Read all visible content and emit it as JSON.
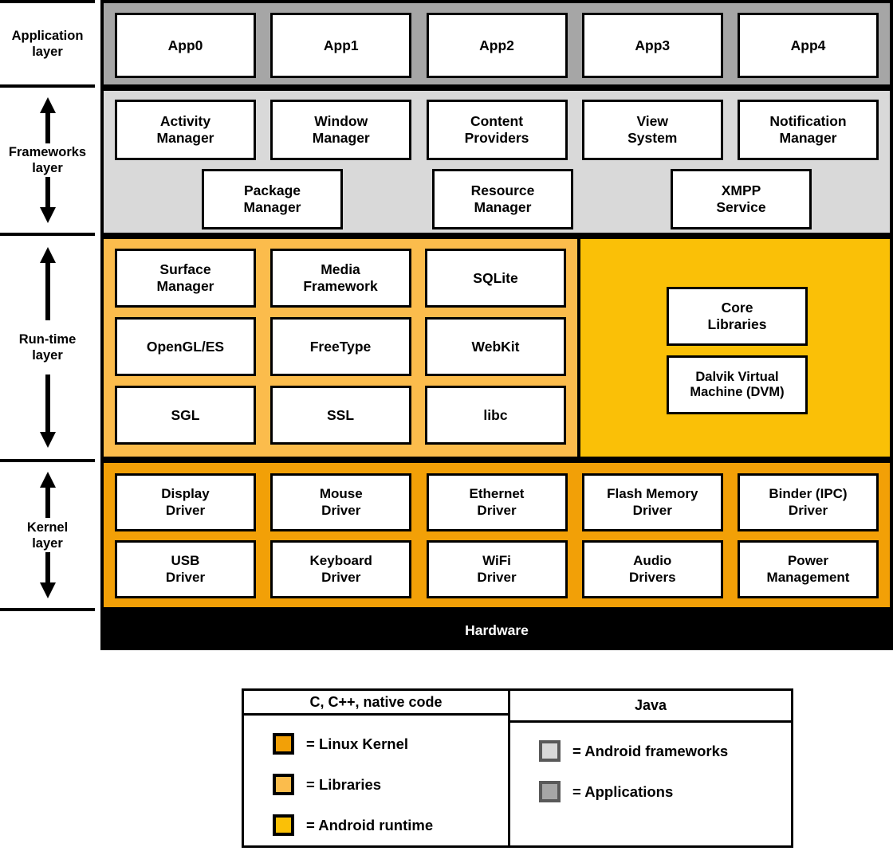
{
  "colors": {
    "applications": "#a6a6a6",
    "frameworks": "#d9d9d9",
    "libraries": "#fbbc4c",
    "android_runtime": "#fac007",
    "linux_kernel": "#f2a007",
    "hardware": "#000000"
  },
  "layer_labels": [
    {
      "label": "Application\nlayer",
      "arrows": false
    },
    {
      "label": "Frameworks\nlayer",
      "arrows": true
    },
    {
      "label": "Run-time\nlayer",
      "arrows": true
    },
    {
      "label": "Kernel\nlayer",
      "arrows": true
    }
  ],
  "application_layer": {
    "apps": [
      "App0",
      "App1",
      "App2",
      "App3",
      "App4"
    ]
  },
  "frameworks_layer": {
    "row1": [
      "Activity\nManager",
      "Window\nManager",
      "Content\nProviders",
      "View\nSystem",
      "Notification\nManager"
    ],
    "row2": [
      "Package\nManager",
      "Resource\nManager",
      "XMPP\nService"
    ]
  },
  "runtime_layer": {
    "libraries": [
      [
        "Surface\nManager",
        "Media\nFramework",
        "SQLite"
      ],
      [
        "OpenGL/ES",
        "FreeType",
        "WebKit"
      ],
      [
        "SGL",
        "SSL",
        "libc"
      ]
    ],
    "android_runtime": [
      "Core\nLibraries",
      "Dalvik Virtual\nMachine (DVM)"
    ]
  },
  "kernel_layer": {
    "row1": [
      "Display\nDriver",
      "Mouse\nDriver",
      "Ethernet\nDriver",
      "Flash Memory\nDriver",
      "Binder (IPC)\nDriver"
    ],
    "row2": [
      "USB\nDriver",
      "Keyboard\nDriver",
      "WiFi\nDriver",
      "Audio\nDrivers",
      "Power\nManagement"
    ]
  },
  "hardware": {
    "label": "Hardware"
  },
  "legend": {
    "left": {
      "heading": "C, C++, native code",
      "items": [
        {
          "label": "= Linux Kernel",
          "color": "#f2a007"
        },
        {
          "label": "= Libraries",
          "color": "#fbbc4c"
        },
        {
          "label": "= Android runtime",
          "color": "#fac007"
        }
      ]
    },
    "right": {
      "heading": "Java",
      "items": [
        {
          "label": "= Android frameworks",
          "color": "#d9d9d9"
        },
        {
          "label": "= Applications",
          "color": "#a6a6a6"
        }
      ]
    }
  }
}
